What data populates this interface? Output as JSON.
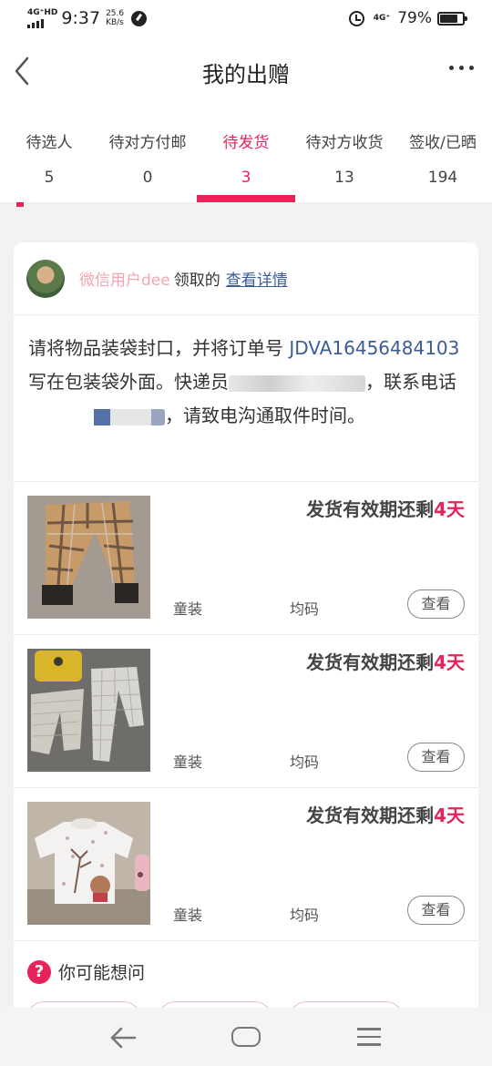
{
  "status_bar": {
    "network": "4G⁺HD",
    "time": "9:37",
    "speed_value": "25.6",
    "speed_unit": "KB/s",
    "signal_right": "4G⁺",
    "battery": "79%"
  },
  "header": {
    "title": "我的出赠"
  },
  "tabs": [
    {
      "label": "待选人",
      "count": "5"
    },
    {
      "label": "待对方付邮",
      "count": "0"
    },
    {
      "label": "待发货",
      "count": "3"
    },
    {
      "label": "待对方收货",
      "count": "13"
    },
    {
      "label": "签收/已晒",
      "count": "194"
    }
  ],
  "active_tab_index": 2,
  "card": {
    "user_name": "微信用户dee",
    "claimed_text": "领取的",
    "detail_link": "查看详情",
    "notice": {
      "part1": "请将物品装袋封口，并将订单号 ",
      "order_no": "JDVA16456484103",
      "part2": " 写在包装袋外面。快递员",
      "part3": "，联系电话",
      "part4": "，请致电沟通取件时间。"
    },
    "items": [
      {
        "deadline_prefix": "发货有效期还剩",
        "deadline_days": "4天",
        "category": "童装",
        "size": "均码",
        "view_label": "查看"
      },
      {
        "deadline_prefix": "发货有效期还剩",
        "deadline_days": "4天",
        "category": "童装",
        "size": "均码",
        "view_label": "查看"
      },
      {
        "deadline_prefix": "发货有效期还剩",
        "deadline_days": "4天",
        "category": "童装",
        "size": "均码",
        "view_label": "查看"
      }
    ],
    "faq": {
      "icon": "?",
      "title": "你可能想问"
    }
  },
  "colors": {
    "accent": "#e6245a",
    "link": "#3a5d96",
    "username": "#f2a6b0"
  }
}
